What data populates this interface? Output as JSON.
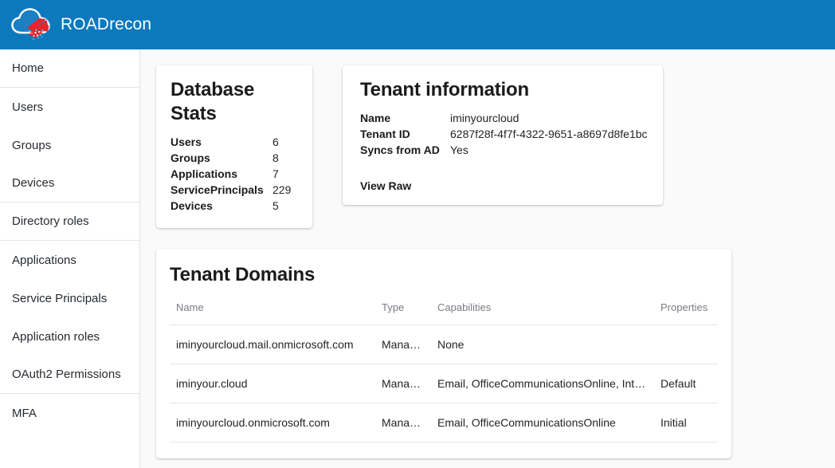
{
  "app": {
    "title": "ROADrecon",
    "logo_icon": "cloud-explosion-icon",
    "header_color": "#0c79bd",
    "background_color": "#fafafa"
  },
  "sidebar": {
    "items": [
      {
        "label": "Home",
        "name": "home",
        "divider_after": true
      },
      {
        "label": "Users",
        "name": "users",
        "divider_after": false
      },
      {
        "label": "Groups",
        "name": "groups",
        "divider_after": false
      },
      {
        "label": "Devices",
        "name": "devices",
        "divider_after": true
      },
      {
        "label": "Directory roles",
        "name": "directory-roles",
        "divider_after": true
      },
      {
        "label": "Applications",
        "name": "applications",
        "divider_after": false
      },
      {
        "label": "Service Principals",
        "name": "service-principals",
        "divider_after": false
      },
      {
        "label": "Application roles",
        "name": "application-roles",
        "divider_after": false
      },
      {
        "label": "OAuth2 Permissions",
        "name": "oauth2-permissions",
        "divider_after": true
      },
      {
        "label": "MFA",
        "name": "mfa",
        "divider_after": false
      }
    ]
  },
  "database_stats": {
    "title": "Database Stats",
    "rows": [
      {
        "label": "Users",
        "value": "6"
      },
      {
        "label": "Groups",
        "value": "8"
      },
      {
        "label": "Applications",
        "value": "7"
      },
      {
        "label": "ServicePrincipals",
        "value": "229"
      },
      {
        "label": "Devices",
        "value": "5"
      }
    ]
  },
  "tenant_information": {
    "title": "Tenant information",
    "rows": [
      {
        "label": "Name",
        "value": "iminyourcloud"
      },
      {
        "label": "Tenant ID",
        "value": "6287f28f-4f7f-4322-9651-a8697d8fe1bc"
      },
      {
        "label": "Syncs from AD",
        "value": "Yes"
      }
    ],
    "view_raw_label": "View Raw"
  },
  "tenant_domains": {
    "title": "Tenant Domains",
    "columns": [
      "Name",
      "Type",
      "Capabilities",
      "Properties"
    ],
    "rows": [
      {
        "name": "iminyourcloud.mail.onmicrosoft.com",
        "type": "Managed",
        "capabilities": "None",
        "properties": ""
      },
      {
        "name": "iminyour.cloud",
        "type": "Managed",
        "capabilities": "Email, OfficeCommunicationsOnline, Intune",
        "properties": "Default"
      },
      {
        "name": "iminyourcloud.onmicrosoft.com",
        "type": "Managed",
        "capabilities": "Email, OfficeCommunicationsOnline",
        "properties": "Initial"
      }
    ]
  }
}
